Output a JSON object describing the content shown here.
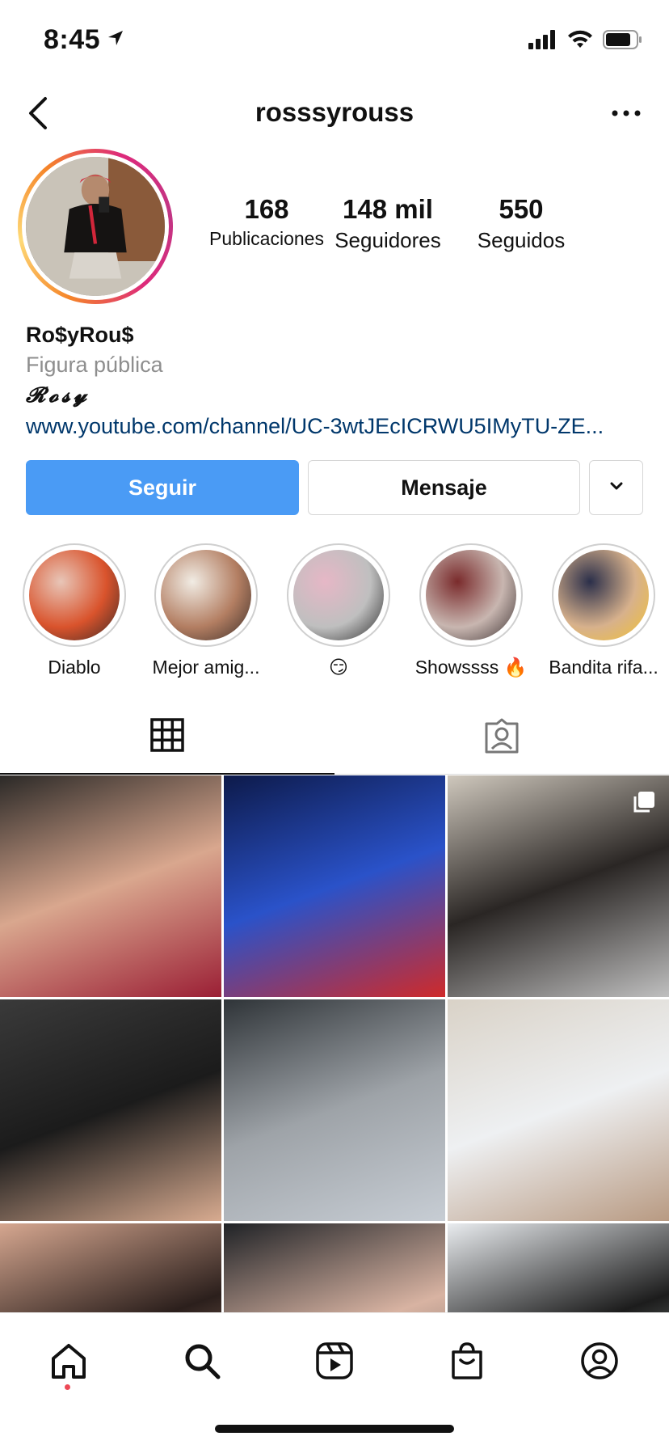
{
  "status_bar": {
    "time": "8:45"
  },
  "header": {
    "username": "rosssyrouss"
  },
  "profile": {
    "stats": [
      {
        "value": "168",
        "label": "Publicaciones"
      },
      {
        "value": "148 mil",
        "label": "Seguidores"
      },
      {
        "value": "550",
        "label": "Seguidos"
      }
    ],
    "name": "Ro$yRou$",
    "category": "Figura pública",
    "bio": "𝓡𝓸𝓼𝔂",
    "link": "www.youtube.com/channel/UC-3wtJEcICRWU5IMyTU-ZE..."
  },
  "actions": {
    "follow": "Seguir",
    "message": "Mensaje"
  },
  "highlights": [
    {
      "label": "Diablo",
      "colors": [
        "#e8c6b8",
        "#d9532c",
        "#3a2a26"
      ]
    },
    {
      "label": "Mejor amig...",
      "colors": [
        "#f1ece4",
        "#b37e62",
        "#3a2d28"
      ]
    },
    {
      "label": "😏",
      "colors": [
        "#e6b7c6",
        "#bfbfbf",
        "#2a2a2a"
      ]
    },
    {
      "label": "Showssss 🔥",
      "colors": [
        "#7a2b2c",
        "#c8b6b0",
        "#3b3030"
      ]
    },
    {
      "label": "Bandita rifa...",
      "colors": [
        "#2b2f4a",
        "#d7b18c",
        "#f2c230"
      ]
    }
  ],
  "grid_posts": [
    {
      "colors": [
        "#2b2927",
        "#d9a78e",
        "#9b1f35"
      ]
    },
    {
      "colors": [
        "#0d1a4a",
        "#2a52c9",
        "#cf2a2a"
      ]
    },
    {
      "colors": [
        "#cfc8bd",
        "#2a2624",
        "#bfbfbf"
      ]
    },
    {
      "colors": [
        "#3a3a3a",
        "#1b1b1b",
        "#d8ab90"
      ]
    },
    {
      "colors": [
        "#2f3438",
        "#9ea3a8",
        "#c7cdd4"
      ]
    },
    {
      "colors": [
        "#d9d2c7",
        "#eef0f2",
        "#b89a82"
      ]
    },
    {
      "colors": [
        "#d6a790",
        "#2b1f1c",
        "#cfa28a"
      ]
    },
    {
      "colors": [
        "#1f2226",
        "#d8b3a2",
        "#44464a"
      ]
    },
    {
      "colors": [
        "#e9ecef",
        "#1c1c1c",
        "#c9d9d2"
      ]
    }
  ],
  "colors": {
    "follow_blue": "#4a9bf5",
    "link_blue": "#00376b",
    "notification_red": "#ed4956"
  }
}
